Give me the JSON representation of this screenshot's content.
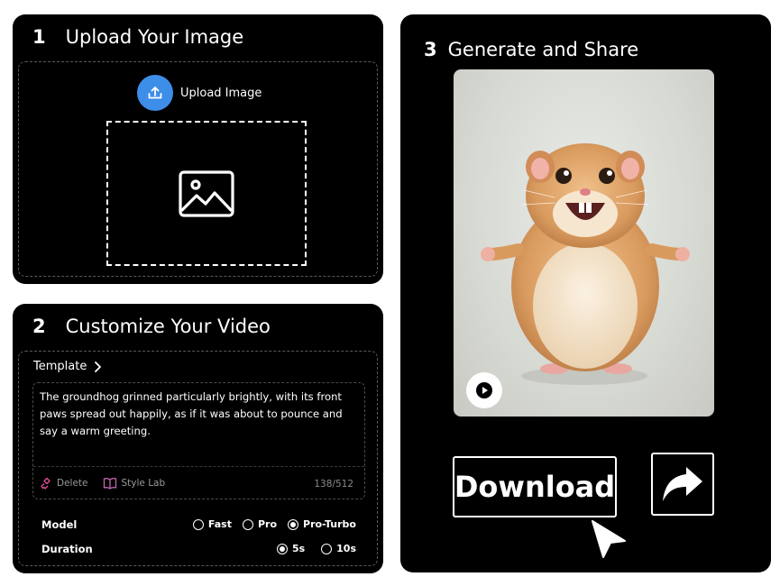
{
  "step1": {
    "number": "1",
    "title": "Upload Your Image",
    "upload_label": "Upload Image",
    "icon_upload": "upload-icon",
    "icon_placeholder": "image-icon"
  },
  "step2": {
    "number": "2",
    "title": "Customize Your Video",
    "template_label": "Template",
    "prompt": "The groundhog grinned particularly brightly, with its front paws spread out happily, as if it was about to pounce and say a warm greeting.",
    "delete_label": "Delete",
    "style_lab_label": "Style Lab",
    "counter": "138/512",
    "model_label": "Model",
    "model_options": [
      "Fast",
      "Pro",
      "Pro-Turbo"
    ],
    "model_selected": "Pro-Turbo",
    "duration_label": "Duration",
    "duration_options": [
      "5s",
      "10s"
    ],
    "duration_selected": "5s"
  },
  "step3": {
    "number": "3",
    "title": "Generate and Share",
    "download_label": "Download",
    "icon_share": "share-arrow-icon",
    "icon_play": "play-icon"
  },
  "colors": {
    "panel": "#000000",
    "accent_upload": "#3d8ee8",
    "delete_icon": "#e0519a",
    "style_lab_icon": "#c466b0"
  }
}
